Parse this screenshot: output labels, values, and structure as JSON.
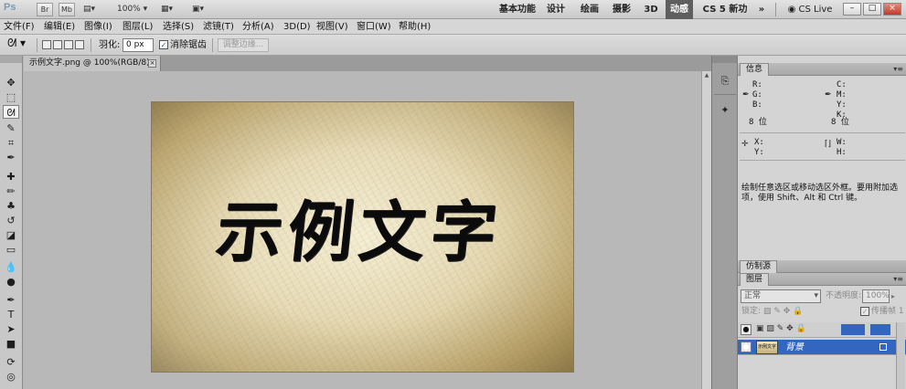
{
  "titlebar": {
    "logo": "Ps",
    "bridge": "Br",
    "mini_bridge": "Mb",
    "zoom": "100%",
    "workspaces": [
      "基本功能",
      "设计",
      "绘画",
      "摄影",
      "3D",
      "动感",
      "CS 5 新功能"
    ],
    "active_workspace": "动感",
    "more": "»",
    "cs_live": "CS Live",
    "win_buttons": [
      "–",
      "□",
      "×"
    ]
  },
  "menu": [
    "文件(F)",
    "编辑(E)",
    "图像(I)",
    "图层(L)",
    "选择(S)",
    "滤镜(T)",
    "分析(A)",
    "3D(D)",
    "视图(V)",
    "窗口(W)",
    "帮助(H)"
  ],
  "options": {
    "feather_label": "羽化:",
    "feather_value": "0 px",
    "antialias_label": "消除锯齿",
    "antialias_checked": true,
    "refine_edge": "调整边缘..."
  },
  "document": {
    "tab_title": "示例文字.png @ 100%(RGB/8)",
    "tab_close": "×",
    "canvas_text": "示例文字"
  },
  "info_panel": {
    "tab": "信息",
    "rgb": "R:\nG:\nB:",
    "cmyk": "C:\nM:\nY:\nK:",
    "bit_left": "8 位",
    "bit_right": "8 位",
    "xy": "X:\nY:",
    "wh": "W:\nH:",
    "hint": "绘制任意选区或移动选区外框。要用附加选项，使用 Shift、Alt 和 Ctrl 键。"
  },
  "clone_panel": {
    "tab": "仿制源"
  },
  "layers_panel": {
    "tab": "图层",
    "blend_mode": "正常",
    "opacity_label": "不透明度:",
    "opacity_value": "100%",
    "lock_label": "锁定:",
    "fill_label": "传播帧 1",
    "layers": [
      {
        "name": "背景",
        "thumb_text": "示例文字",
        "selected": true
      }
    ]
  },
  "colors": {
    "selection_blue": "#3266c0",
    "active_workspace_bg": "#5f5f5f"
  }
}
